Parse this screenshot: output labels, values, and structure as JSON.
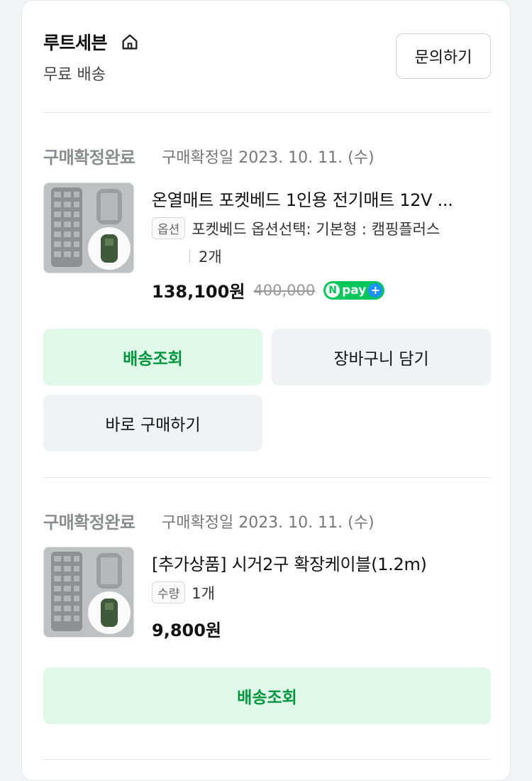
{
  "store": {
    "name": "루트세븐",
    "shipping": "무료 배송",
    "inquiry_label": "문의하기"
  },
  "orders": [
    {
      "status": "구매확정완료",
      "confirm_date": "구매확정일 2023. 10. 11. (수)",
      "title": "온열매트 포켓베드 1인용 전기매트 12V ...",
      "option_tag": "옵션",
      "option_text": "포켓베드 옵션선택: 기본형 : 캠핑플러스",
      "quantity": "2개",
      "price": "138,100원",
      "original_price": "400,000",
      "npay_label": "pay",
      "buttons": {
        "track": "배송조회",
        "cart": "장바구니 담기",
        "buy_now": "바로 구매하기"
      }
    },
    {
      "status": "구매확정완료",
      "confirm_date": "구매확정일 2023. 10. 11. (수)",
      "title": "[추가상품] 시거2구 확장케이블(1.2m)",
      "qty_tag": "수량",
      "quantity": "1개",
      "price": "9,800원",
      "buttons": {
        "track": "배송조회"
      }
    }
  ],
  "colors": {
    "accent_green": "#03963f",
    "green_button_bg": "#dff8e7",
    "gray_button_bg": "#f1f2f4"
  }
}
